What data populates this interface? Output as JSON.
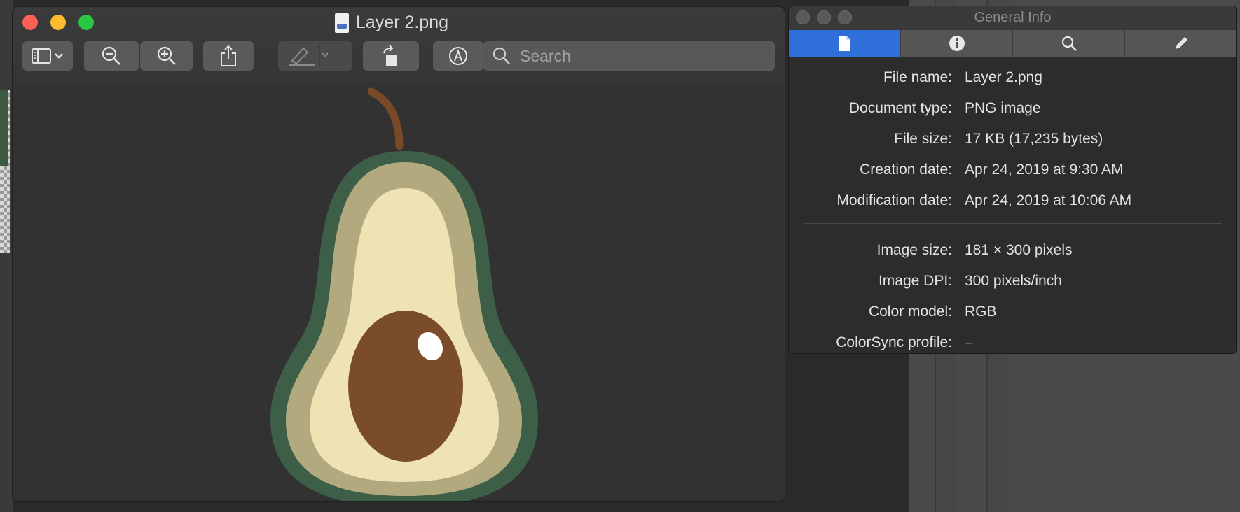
{
  "preview_window": {
    "title": "Layer 2.png",
    "search_placeholder": "Search"
  },
  "info_window": {
    "title": "General Info",
    "tabs": [
      "general-info",
      "more-info",
      "search",
      "edit"
    ],
    "general": [
      {
        "label": "File name:",
        "value": "Layer 2.png"
      },
      {
        "label": "Document type:",
        "value": "PNG image"
      },
      {
        "label": "File size:",
        "value": "17 KB (17,235 bytes)"
      },
      {
        "label": "Creation date:",
        "value": "Apr 24, 2019 at 9:30 AM"
      },
      {
        "label": "Modification date:",
        "value": "Apr 24, 2019 at 10:06 AM"
      }
    ],
    "image": [
      {
        "label": "Image size:",
        "value": "181 × 300 pixels"
      },
      {
        "label": "Image DPI:",
        "value": "300 pixels/inch"
      },
      {
        "label": "Color model:",
        "value": "RGB"
      },
      {
        "label": "ColorSync profile:",
        "value": "–"
      }
    ]
  },
  "colors": {
    "active_tab": "#2f6fd9",
    "avocado_skin": "#3d5e47",
    "avocado_flesh_outer": "#b3a97f",
    "avocado_flesh_inner": "#efe2b3",
    "avocado_pit": "#7b4c29",
    "stem": "#7a4a28"
  }
}
